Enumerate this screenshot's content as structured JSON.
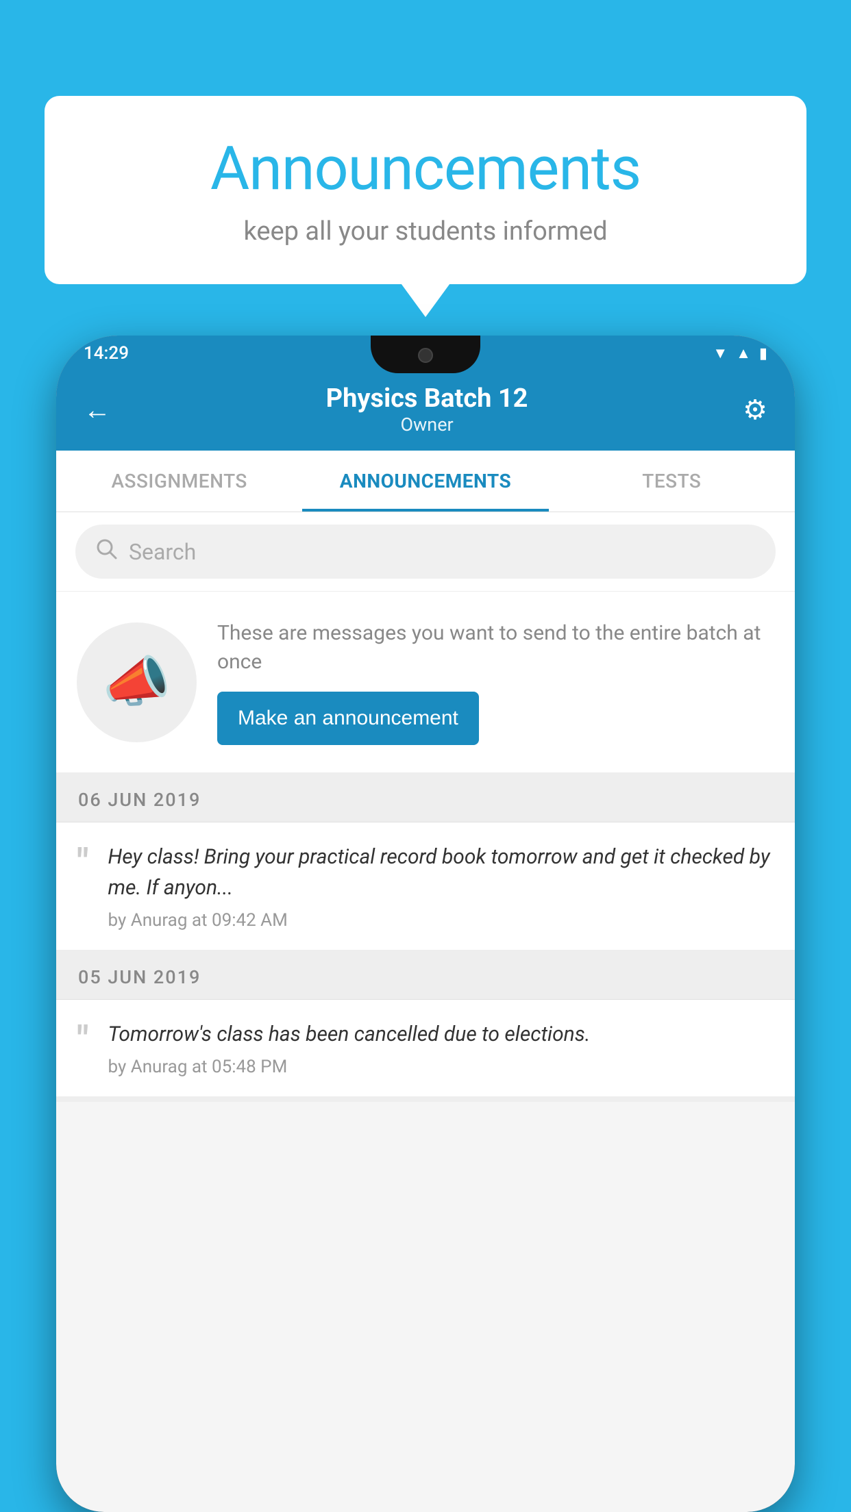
{
  "background_color": "#29b6e8",
  "speech_bubble": {
    "title": "Announcements",
    "subtitle": "keep all your students informed"
  },
  "phone": {
    "status_bar": {
      "time": "14:29",
      "icons": [
        "wifi",
        "signal",
        "battery"
      ]
    },
    "header": {
      "back_label": "←",
      "title": "Physics Batch 12",
      "subtitle": "Owner",
      "gear_label": "⚙"
    },
    "tabs": [
      {
        "label": "ASSIGNMENTS",
        "active": false
      },
      {
        "label": "ANNOUNCEMENTS",
        "active": true
      },
      {
        "label": "TESTS",
        "active": false
      },
      {
        "label": "•••",
        "active": false
      }
    ],
    "search": {
      "placeholder": "Search"
    },
    "announcement_prompt": {
      "description": "These are messages you want to send to the entire batch at once",
      "button_label": "Make an announcement"
    },
    "announcements": [
      {
        "date": "06  JUN  2019",
        "body": "Hey class! Bring your practical record book tomorrow and get it checked by me. If anyon...",
        "meta": "by Anurag at 09:42 AM"
      },
      {
        "date": "05  JUN  2019",
        "body": "Tomorrow's class has been cancelled due to elections.",
        "meta": "by Anurag at 05:48 PM"
      }
    ]
  }
}
